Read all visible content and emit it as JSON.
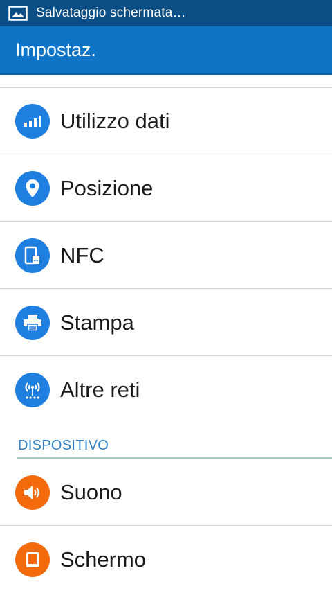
{
  "status_bar": {
    "notification_text": "Salvataggio schermata…"
  },
  "app_bar": {
    "title": "Impostaz."
  },
  "items": [
    {
      "label": "Utilizzo dati",
      "icon": "data-usage-icon",
      "color": "#1f7fe0"
    },
    {
      "label": "Posizione",
      "icon": "location-pin-icon",
      "color": "#1f7fe0"
    },
    {
      "label": "NFC",
      "icon": "nfc-icon",
      "color": "#1f7fe0"
    },
    {
      "label": "Stampa",
      "icon": "printer-icon",
      "color": "#1f7fe0"
    },
    {
      "label": "Altre reti",
      "icon": "wireless-tower-icon",
      "color": "#1f7fe0"
    }
  ],
  "section": {
    "header": "DISPOSITIVO"
  },
  "device_items": [
    {
      "label": "Suono",
      "icon": "speaker-icon",
      "color": "#f26a0c"
    },
    {
      "label": "Schermo",
      "icon": "display-icon",
      "color": "#f26a0c"
    }
  ]
}
